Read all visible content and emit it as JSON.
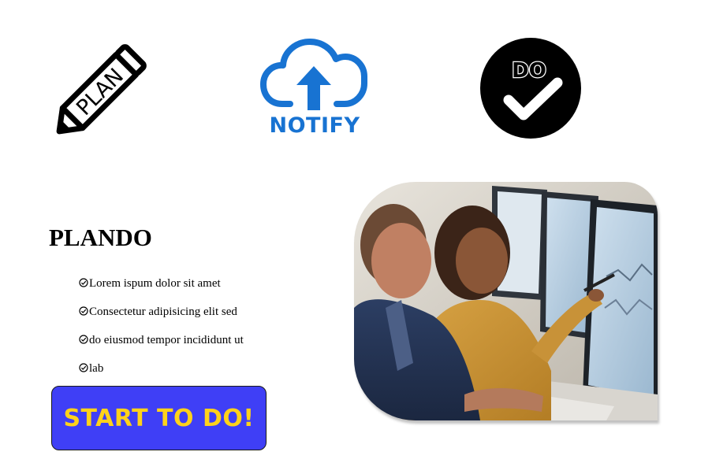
{
  "icons": {
    "plan": {
      "name": "plan-pencil-icon",
      "text": "PLAN"
    },
    "notify": {
      "name": "cloud-upload-icon",
      "label": "NOTIFY",
      "color": "#1873d2"
    },
    "do": {
      "name": "do-check-icon",
      "text": "DO"
    }
  },
  "brand": {
    "title": "PLANDO"
  },
  "features": [
    {
      "text": "Lorem ispum dolor sit amet",
      "icon": "clock-check-icon"
    },
    {
      "text": "Consectetur adipisicing elit sed",
      "icon": "clock-check-icon"
    },
    {
      "text": "do eiusmod tempor incididunt ut",
      "icon": "clock-check-icon"
    },
    {
      "text": "lab",
      "icon": "clock-check-icon"
    }
  ],
  "cta": {
    "label": "START TO DO!",
    "background": "#3f3ff6",
    "text_color": "#ffd21a"
  },
  "photo": {
    "subject": "two people smiling at computer monitors"
  }
}
